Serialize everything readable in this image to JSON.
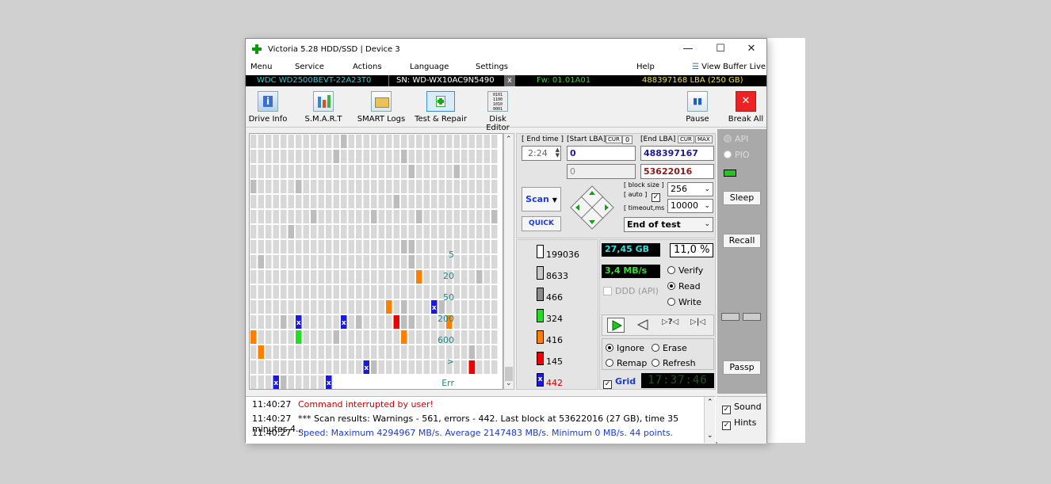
{
  "window": {
    "title": "Victoria 5.28 HDD/SSD | Device 3",
    "btn_min": "—",
    "btn_max": "☐",
    "btn_close": "✕"
  },
  "menu": {
    "items": [
      "Menu",
      "Service",
      "Actions",
      "Language",
      "Settings"
    ],
    "help": "Help",
    "view_buffer": "View Buffer Live"
  },
  "info": {
    "model": "WDC WD2500BEVT-22A23T0",
    "serial": "SN: WD-WX10AC9N5490",
    "x": "x",
    "fw": "Fw: 01.01A01",
    "lba": "488397168 LBA (250 GB)"
  },
  "toolbar": {
    "drive_info": "Drive Info",
    "smart": "S.M.A.R.T",
    "smart_logs": "SMART Logs",
    "test_repair": "Test & Repair",
    "disk_editor": "Disk Editor",
    "pause": "Pause",
    "break_all": "Break All"
  },
  "params": {
    "end_time_label": "[ End time ]",
    "end_time": "2:24",
    "start_lba_label": "[Start LBA]",
    "cur": "CUR",
    "zero": "0",
    "end_lba_label": "[End LBA]",
    "max": "MAX",
    "start_lba": "0",
    "end_lba": "488397167",
    "pos_start": "0",
    "pos_end": "53622016",
    "block_size_label": "[ block size ]",
    "auto_label": "[ auto ]",
    "block_size": "256",
    "timeout_label": "[ timeout,ms ]",
    "timeout": "10000",
    "scan": "Scan",
    "quick": "QUICK",
    "end_of_test": "End of test"
  },
  "legend": [
    {
      "label": "5",
      "count": "199036",
      "color": "#ffffff"
    },
    {
      "label": "20",
      "count": "8633",
      "color": "#c8c8c8"
    },
    {
      "label": "50",
      "count": "466",
      "color": "#8c8c8c"
    },
    {
      "label": "200",
      "count": "324",
      "color": "#22dd22"
    },
    {
      "label": "600",
      "count": "416",
      "color": "#ff8000"
    },
    {
      "label": ">",
      "count": "145",
      "color": "#ee0000"
    },
    {
      "label": "Err",
      "count": "442",
      "color": "#1a1adc"
    }
  ],
  "status": {
    "size": "27,45 GB",
    "percent": "11,0",
    "pct_sign": "%",
    "speed": "3,4 MB/s",
    "ddd": "DDD (API)",
    "verify": "Verify",
    "read": "Read",
    "write": "Write"
  },
  "mode": {
    "ignore": "Ignore",
    "erase": "Erase",
    "remap": "Remap",
    "refresh": "Refresh",
    "grid": "Grid",
    "clock": "17:37:46"
  },
  "right": {
    "api": "API",
    "pio": "PIO",
    "sleep": "Sleep",
    "recall": "Recall",
    "passp": "Passp"
  },
  "log": [
    {
      "time": "11:40:27",
      "text": "Command interrupted by user!",
      "color": "#d00000"
    },
    {
      "time": "11:40:27",
      "text": "*** Scan results: Warnings - 561, errors - 442. Last block at 53622016 (27 GB), time 35 minutes 4...",
      "color": "#000000"
    },
    {
      "time": "11:40:27",
      "text": "Speed: Maximum 4294967 MB/s. Average 2147483 MB/s. Minimum 0 MB/s. 44 points.",
      "color": "#1a3adc"
    }
  ],
  "options": {
    "sound": "Sound",
    "hints": "Hints"
  },
  "grid_marks": "x"
}
